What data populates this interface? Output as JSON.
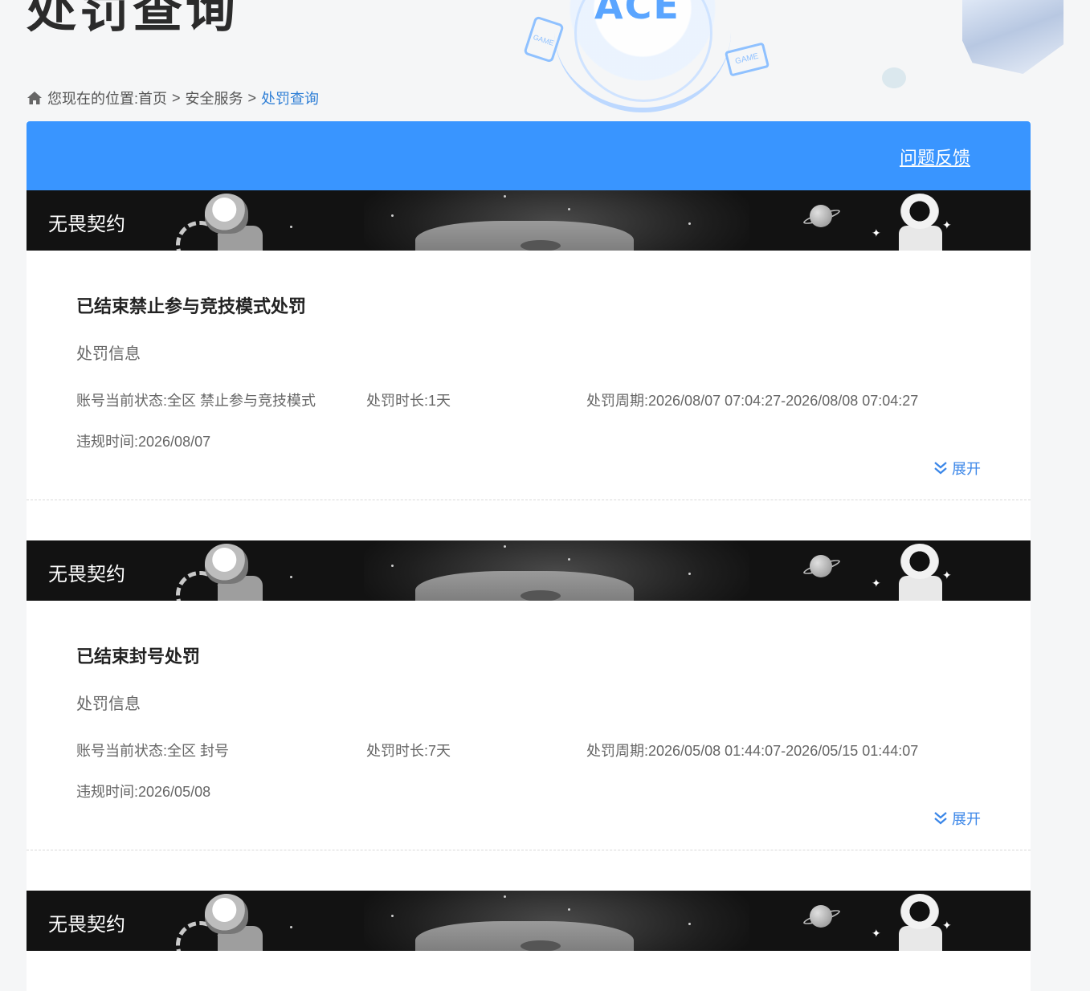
{
  "page": {
    "title": "处罚查询"
  },
  "breadcrumb": {
    "prefix": "您现在的位置:",
    "items": [
      "首页",
      "安全服务"
    ],
    "separator": ">",
    "current": "处罚查询"
  },
  "header_art": {
    "logo_text": "ACE",
    "tag_left": "GAME",
    "tag_right": "GAME"
  },
  "topbar": {
    "feedback_label": "问题反馈",
    "color": "#3995ff"
  },
  "records": [
    {
      "game": "无畏契约",
      "title": "已结束禁止参与竞技模式处罚",
      "subtitle": "处罚信息",
      "status_label": "账号当前状态:",
      "status_value": "全区 禁止参与竞技模式",
      "duration_label": "处罚时长:",
      "duration_value": "1天",
      "period_label": "处罚周期:",
      "period_value": "2026/08/07 07:04:27-2026/08/08 07:04:27",
      "violation_label": "违规时间:",
      "violation_value": "2026/08/07",
      "expand_label": "展开"
    },
    {
      "game": "无畏契约",
      "title": "已结束封号处罚",
      "subtitle": "处罚信息",
      "status_label": "账号当前状态:",
      "status_value": "全区 封号",
      "duration_label": "处罚时长:",
      "duration_value": "7天",
      "period_label": "处罚周期:",
      "period_value": "2026/05/08 01:44:07-2026/05/15 01:44:07",
      "violation_label": "违规时间:",
      "violation_value": "2026/05/08",
      "expand_label": "展开"
    },
    {
      "game": "无畏契约"
    }
  ],
  "icons": {
    "home": "home-icon",
    "expand": "chevron-double-down-icon"
  },
  "colors": {
    "accent": "#3995ff",
    "link": "#3a86e8",
    "breadcrumb_current": "#2f7fd6"
  }
}
